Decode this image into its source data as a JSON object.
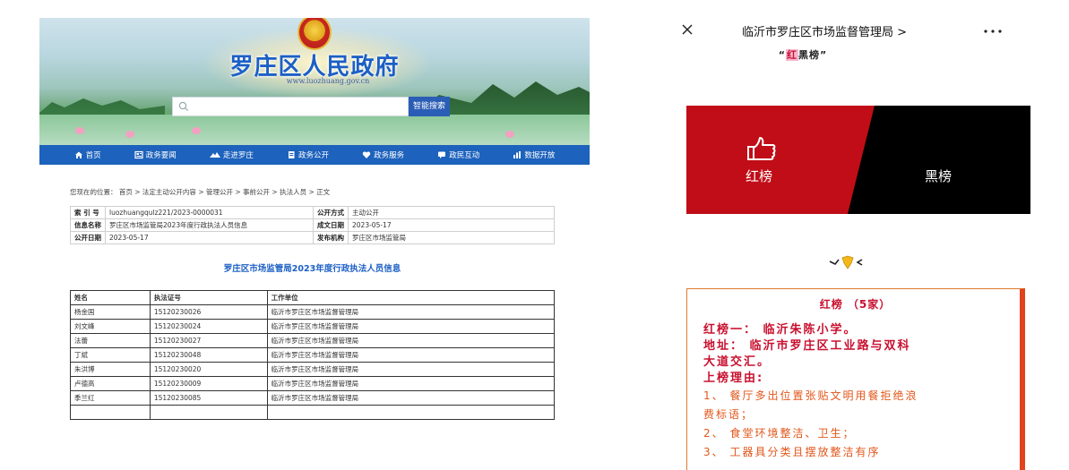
{
  "left": {
    "site_title": "罗庄区人民政府",
    "site_url": "www.luozhuang.gov.cn",
    "search": {
      "placeholder": "",
      "button_label": "智能搜索"
    },
    "nav": [
      {
        "label": "首页",
        "icon": "home-icon"
      },
      {
        "label": "政务要闻",
        "icon": "news-icon"
      },
      {
        "label": "走进罗庄",
        "icon": "landscape-icon"
      },
      {
        "label": "政务公开",
        "icon": "document-icon"
      },
      {
        "label": "政务服务",
        "icon": "heart-icon"
      },
      {
        "label": "政民互动",
        "icon": "chat-icon"
      },
      {
        "label": "数据开放",
        "icon": "bar-chart-icon"
      }
    ],
    "breadcrumb": "您现在的位置： 首页 > 法定主动公开内容 > 管理公开 > 事前公开 > 执法人员 > 正文",
    "meta": {
      "index_label": "索 引 号",
      "index_value": "luozhuangqulz221/2023-0000031",
      "mode_label": "公开方式",
      "mode_value": "主动公开",
      "name_label": "信息名称",
      "name_value": "罗庄区市场监管局2023年度行政执法人员信息",
      "made_label": "成文日期",
      "made_value": "2023-05-17",
      "pub_label": "公开日期",
      "pub_value": "2023-05-17",
      "org_label": "发布机构",
      "org_value": "罗庄区市场监管局"
    },
    "doc_title": "罗庄区市场监管局2023年度行政执法人员信息",
    "table": {
      "headers": [
        "姓名",
        "执法证号",
        "工作单位"
      ],
      "rows": [
        [
          "杨金国",
          "15120230026",
          "临沂市罗庄区市场监督管理局"
        ],
        [
          "刘文峰",
          "15120230024",
          "临沂市罗庄区市场监督管理局"
        ],
        [
          "法蕾",
          "15120230027",
          "临沂市罗庄区市场监督管理局"
        ],
        [
          "丁斌",
          "15120230048",
          "临沂市罗庄区市场监督管理局"
        ],
        [
          "朱洪博",
          "15120230020",
          "临沂市罗庄区市场监督管理局"
        ],
        [
          "卢德高",
          "15120230009",
          "临沂市罗庄区市场监督管理局"
        ],
        [
          "季兰红",
          "15120230085",
          "临沂市罗庄区市场监督管理局"
        ]
      ]
    }
  },
  "right": {
    "top_title": "临沂市罗庄区市场监督管理局 >",
    "quote_open": "“",
    "quote_red": "红",
    "quote_black": "黑",
    "quote_rest": "榜",
    "quote_close": "”",
    "red_label": "红榜",
    "black_label": "黑榜",
    "list_title": "红榜 （5家）",
    "entry_name": "红榜一： 临沂朱陈小学。",
    "entry_address_1": "地址： 临沂市罗庄区工业路与双科",
    "entry_address_2": "大道交汇。",
    "reason_label": "上榜理由:",
    "reason_1a": "1、 餐厅多出位置张贴文明用餐拒绝浪",
    "reason_1b": "费标语；",
    "reason_2": "2、 食堂环境整洁、卫生；",
    "reason_3": "3、 工器具分类且摆放整洁有序",
    "colors": {
      "nav_blue": "#1d62bc",
      "title_blue": "#1c5fc6",
      "red": "#c00d17",
      "orange": "#e2561a"
    }
  }
}
